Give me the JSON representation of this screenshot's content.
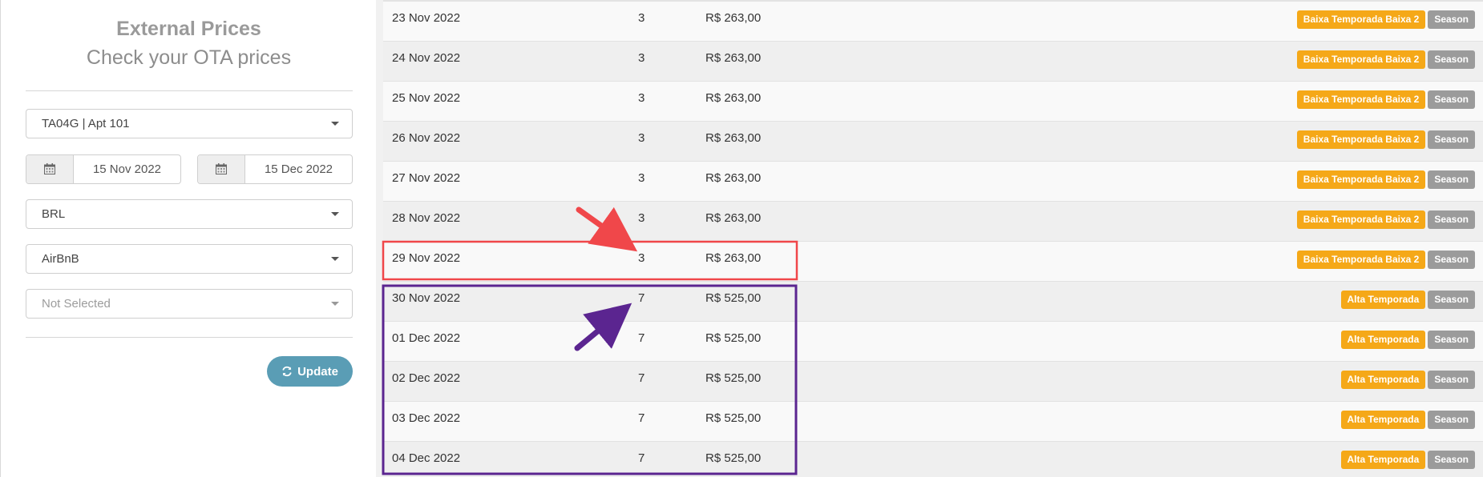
{
  "panel": {
    "title": "External Prices",
    "subtitle": "Check your OTA prices",
    "property_select": "TA04G | Apt 101",
    "date_from": "15 Nov 2022",
    "date_to": "15 Dec 2022",
    "currency_select": "BRL",
    "channel_select": "AirBnB",
    "extra_select": "Not Selected",
    "update_label": "Update"
  },
  "rows": [
    {
      "date": "23 Nov 2022",
      "min": "3",
      "price": "R$ 263,00",
      "season": "Baixa Temporada Baixa 2",
      "tag": "Season"
    },
    {
      "date": "24 Nov 2022",
      "min": "3",
      "price": "R$ 263,00",
      "season": "Baixa Temporada Baixa 2",
      "tag": "Season"
    },
    {
      "date": "25 Nov 2022",
      "min": "3",
      "price": "R$ 263,00",
      "season": "Baixa Temporada Baixa 2",
      "tag": "Season"
    },
    {
      "date": "26 Nov 2022",
      "min": "3",
      "price": "R$ 263,00",
      "season": "Baixa Temporada Baixa 2",
      "tag": "Season"
    },
    {
      "date": "27 Nov 2022",
      "min": "3",
      "price": "R$ 263,00",
      "season": "Baixa Temporada Baixa 2",
      "tag": "Season"
    },
    {
      "date": "28 Nov 2022",
      "min": "3",
      "price": "R$ 263,00",
      "season": "Baixa Temporada Baixa 2",
      "tag": "Season"
    },
    {
      "date": "29 Nov 2022",
      "min": "3",
      "price": "R$ 263,00",
      "season": "Baixa Temporada Baixa 2",
      "tag": "Season"
    },
    {
      "date": "30 Nov 2022",
      "min": "7",
      "price": "R$ 525,00",
      "season": "Alta Temporada",
      "tag": "Season"
    },
    {
      "date": "01 Dec 2022",
      "min": "7",
      "price": "R$ 525,00",
      "season": "Alta Temporada",
      "tag": "Season"
    },
    {
      "date": "02 Dec 2022",
      "min": "7",
      "price": "R$ 525,00",
      "season": "Alta Temporada",
      "tag": "Season"
    },
    {
      "date": "03 Dec 2022",
      "min": "7",
      "price": "R$ 525,00",
      "season": "Alta Temporada",
      "tag": "Season"
    },
    {
      "date": "04 Dec 2022",
      "min": "7",
      "price": "R$ 525,00",
      "season": "Alta Temporada",
      "tag": "Season"
    }
  ],
  "colors": {
    "season_badge": "#f5a818",
    "tag_badge": "#9b9b9b",
    "update_button": "#5a9db5",
    "highlight_red": "#f0474a",
    "highlight_purple": "#5b2590"
  }
}
